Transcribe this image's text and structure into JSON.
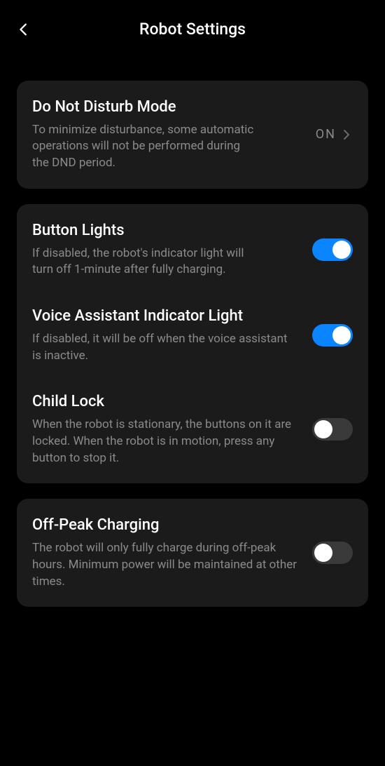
{
  "header": {
    "title": "Robot Settings"
  },
  "dnd": {
    "title": "Do Not Disturb Mode",
    "desc": "To minimize disturbance, some automatic operations will not be performed during the DND period.",
    "value": "ON"
  },
  "buttonLights": {
    "title": "Button Lights",
    "desc": "If disabled, the robot's indicator light will turn off 1-minute after fully charging.",
    "enabled": true
  },
  "voiceAssistant": {
    "title": "Voice Assistant Indicator Light",
    "desc": "If disabled, it will be off when the voice assistant is inactive.",
    "enabled": true
  },
  "childLock": {
    "title": "Child Lock",
    "desc": "When the robot is stationary, the buttons on it are locked. When the robot is in motion, press any button to stop it.",
    "enabled": false
  },
  "offPeak": {
    "title": "Off-Peak Charging",
    "desc": "The robot will only fully charge during off-peak hours. Minimum power will be maintained at other times.",
    "enabled": false
  }
}
